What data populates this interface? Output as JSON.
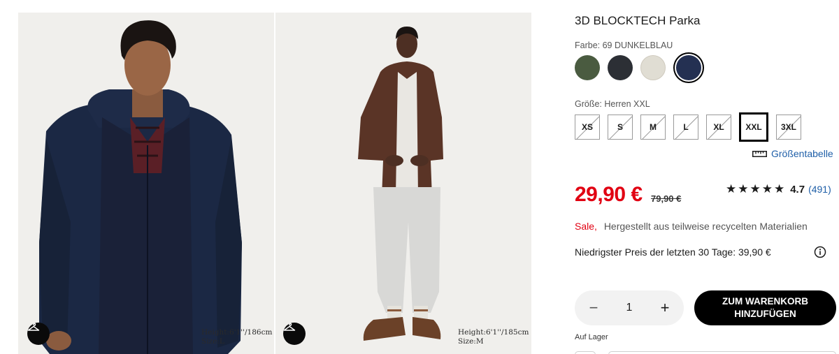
{
  "photos": [
    {
      "height": "Height:6'1''/186cm",
      "size": "Size:L",
      "hanger_icon": "hanger-icon"
    },
    {
      "height": "Height:6'1''/185cm",
      "size": "Size:M",
      "hanger_icon": "hanger-icon"
    }
  ],
  "product": {
    "title": "3D BLOCKTECH Parka",
    "color_label": "Farbe: 69 DUNKELBLAU",
    "colors": [
      "#4a5b40",
      "#2c2f35",
      "#e0ddd3",
      "#243052"
    ],
    "selected_color_index": 3,
    "size_label": "Größe: Herren XXL",
    "sizes": [
      "XS",
      "S",
      "M",
      "L",
      "XL",
      "XXL",
      "3XL"
    ],
    "selected_size": "XXL",
    "size_chart": "Größentabelle",
    "price": "29,90 €",
    "old_price": "79,90 €",
    "stars": "★★★★★",
    "rating": "4.7",
    "rating_value": 4.7,
    "reviews": "(491)",
    "sale_tag": "Sale,",
    "sale_text": "Hergestellt aus teilweise recycelten Materialien",
    "lowest_price": "Niedrigster Preis der letzten 30 Tage: 39,90 €",
    "quantity": "1",
    "qty_minus": "−",
    "qty_plus": "+",
    "cart_button": "ZUM WARENKORB HINZUFÜGEN",
    "stock": "Auf Lager"
  },
  "colors": {
    "sale_red": "#e10012",
    "link_blue": "#1f5fa8"
  }
}
